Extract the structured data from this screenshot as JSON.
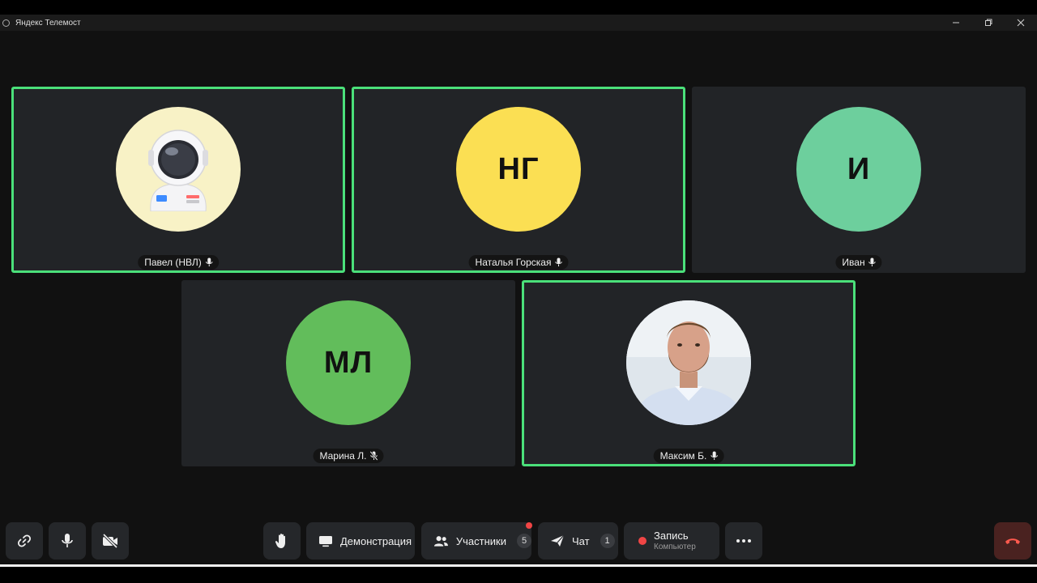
{
  "window": {
    "title": "Яндекс Телемост",
    "controls": [
      "minimize-icon",
      "restore-icon",
      "close-icon"
    ]
  },
  "participants": [
    {
      "name": "Павел (НВЛ)",
      "avatar_type": "astronaut-image",
      "avatar_bg": "#f8f2c6",
      "speaking": true
    },
    {
      "name": "Наталья Горская",
      "initials": "НГ",
      "avatar_bg": "#fbdf53",
      "speaking": true
    },
    {
      "name": "Иван",
      "initials": "И",
      "avatar_bg": "#6dcf9d",
      "speaking": false
    },
    {
      "name": "Марина Л.",
      "initials": "МЛ",
      "avatar_bg": "#62bd5b",
      "speaking": false,
      "mic_muted": true
    },
    {
      "name": "Максим Б.",
      "avatar_type": "photo",
      "avatar_bg": "#dce4ec",
      "speaking": true
    }
  ],
  "toolbar": {
    "link_icon": "link-icon",
    "mic_icon": "microphone-icon",
    "camera_icon": "camera-off-icon",
    "hand_icon": "raise-hand-icon",
    "demo_label": "Демонстрация",
    "participants_label": "Участники",
    "participants_count": "5",
    "chat_label": "Чат",
    "chat_count": "1",
    "record_label": "Запись",
    "record_sublabel": "Компьютер",
    "more_icon": "more-icon",
    "hangup_icon": "hang-up-icon"
  },
  "colors": {
    "active_speaker_border": "#4be07a",
    "tile_bg": "#222427",
    "notification": "#f04545",
    "hangup_bg": "#4a2220"
  }
}
